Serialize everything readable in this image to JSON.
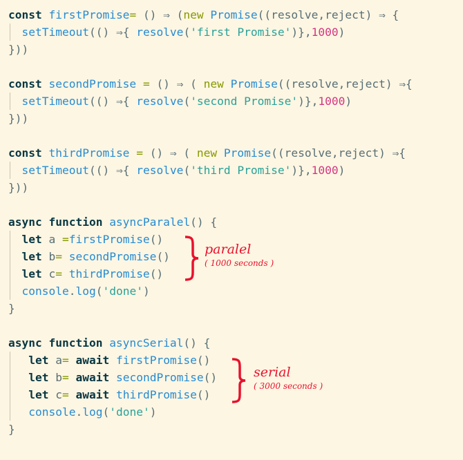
{
  "code_lines": [
    {
      "indent": false,
      "tokens": [
        [
          "const ",
          "kw"
        ],
        [
          "firstPromise",
          "fn"
        ],
        [
          "= ",
          "nw"
        ],
        [
          "() ⇒ (",
          "p"
        ],
        [
          "new ",
          "nw"
        ],
        [
          "Promise",
          "fn"
        ],
        [
          "((resolve,reject) ⇒ {",
          "p"
        ]
      ]
    },
    {
      "indent": true,
      "tokens": [
        [
          "  ",
          ""
        ],
        [
          "setTimeout",
          "fn"
        ],
        [
          "(() ⇒{ ",
          "p"
        ],
        [
          "resolve",
          "fn"
        ],
        [
          "(",
          "p"
        ],
        [
          "'first Promise'",
          "str"
        ],
        [
          ")},",
          "p"
        ],
        [
          "1000",
          "num"
        ],
        [
          ")",
          "p"
        ]
      ]
    },
    {
      "indent": false,
      "tokens": [
        [
          "}))",
          "p"
        ]
      ]
    },
    {
      "indent": false,
      "tokens": []
    },
    {
      "indent": false,
      "tokens": [
        [
          "const ",
          "kw"
        ],
        [
          "secondPromise ",
          "fn"
        ],
        [
          "= ",
          "nw"
        ],
        [
          "() ⇒ ( ",
          "p"
        ],
        [
          "new ",
          "nw"
        ],
        [
          "Promise",
          "fn"
        ],
        [
          "((resolve,reject) ⇒{",
          "p"
        ]
      ]
    },
    {
      "indent": true,
      "tokens": [
        [
          "  ",
          ""
        ],
        [
          "setTimeout",
          "fn"
        ],
        [
          "(() ⇒{ ",
          "p"
        ],
        [
          "resolve",
          "fn"
        ],
        [
          "(",
          "p"
        ],
        [
          "'second Promise'",
          "str"
        ],
        [
          ")},",
          "p"
        ],
        [
          "1000",
          "num"
        ],
        [
          ")",
          "p"
        ]
      ]
    },
    {
      "indent": false,
      "tokens": [
        [
          "}))",
          "p"
        ]
      ]
    },
    {
      "indent": false,
      "tokens": []
    },
    {
      "indent": false,
      "tokens": [
        [
          "const ",
          "kw"
        ],
        [
          "thirdPromise ",
          "fn"
        ],
        [
          "= ",
          "nw"
        ],
        [
          "() ⇒ ( ",
          "p"
        ],
        [
          "new ",
          "nw"
        ],
        [
          "Promise",
          "fn"
        ],
        [
          "((resolve,reject) ⇒{",
          "p"
        ]
      ]
    },
    {
      "indent": true,
      "tokens": [
        [
          "  ",
          ""
        ],
        [
          "setTimeout",
          "fn"
        ],
        [
          "(() ⇒{ ",
          "p"
        ],
        [
          "resolve",
          "fn"
        ],
        [
          "(",
          "p"
        ],
        [
          "'third Promise'",
          "str"
        ],
        [
          ")},",
          "p"
        ],
        [
          "1000",
          "num"
        ],
        [
          ")",
          "p"
        ]
      ]
    },
    {
      "indent": false,
      "tokens": [
        [
          "}))",
          "p"
        ]
      ]
    },
    {
      "indent": false,
      "tokens": []
    },
    {
      "indent": false,
      "tokens": [
        [
          "async function ",
          "kw"
        ],
        [
          "asyncParalel",
          "fn"
        ],
        [
          "() {",
          "p"
        ]
      ]
    },
    {
      "indent": true,
      "tokens": [
        [
          "  ",
          ""
        ],
        [
          "let ",
          "kw"
        ],
        [
          "a ",
          "p"
        ],
        [
          "=",
          "nw"
        ],
        [
          "firstPromise",
          "fn"
        ],
        [
          "()",
          "p"
        ]
      ]
    },
    {
      "indent": true,
      "tokens": [
        [
          "  ",
          ""
        ],
        [
          "let ",
          "kw"
        ],
        [
          "b",
          "p"
        ],
        [
          "= ",
          "nw"
        ],
        [
          "secondPromise",
          "fn"
        ],
        [
          "()",
          "p"
        ]
      ]
    },
    {
      "indent": true,
      "tokens": [
        [
          "  ",
          ""
        ],
        [
          "let ",
          "kw"
        ],
        [
          "c",
          "p"
        ],
        [
          "= ",
          "nw"
        ],
        [
          "thirdPromise",
          "fn"
        ],
        [
          "()",
          "p"
        ]
      ]
    },
    {
      "indent": true,
      "tokens": [
        [
          "  ",
          ""
        ],
        [
          "console",
          "fn"
        ],
        [
          ".",
          "p"
        ],
        [
          "log",
          "fn"
        ],
        [
          "(",
          "p"
        ],
        [
          "'done'",
          "str"
        ],
        [
          ")",
          "p"
        ]
      ]
    },
    {
      "indent": false,
      "tokens": [
        [
          "}",
          "p"
        ]
      ]
    },
    {
      "indent": false,
      "tokens": []
    },
    {
      "indent": false,
      "tokens": [
        [
          "async function ",
          "kw"
        ],
        [
          "asyncSerial",
          "fn"
        ],
        [
          "() {",
          "p"
        ]
      ]
    },
    {
      "indent": true,
      "tokens": [
        [
          "   ",
          ""
        ],
        [
          "let ",
          "kw"
        ],
        [
          "a",
          "p"
        ],
        [
          "= ",
          "nw"
        ],
        [
          "await ",
          "kw"
        ],
        [
          "firstPromise",
          "fn"
        ],
        [
          "()",
          "p"
        ]
      ]
    },
    {
      "indent": true,
      "tokens": [
        [
          "   ",
          ""
        ],
        [
          "let ",
          "kw"
        ],
        [
          "b",
          "p"
        ],
        [
          "= ",
          "nw"
        ],
        [
          "await ",
          "kw"
        ],
        [
          "secondPromise",
          "fn"
        ],
        [
          "()",
          "p"
        ]
      ]
    },
    {
      "indent": true,
      "tokens": [
        [
          "   ",
          ""
        ],
        [
          "let ",
          "kw"
        ],
        [
          "c",
          "p"
        ],
        [
          "= ",
          "nw"
        ],
        [
          "await ",
          "kw"
        ],
        [
          "thirdPromise",
          "fn"
        ],
        [
          "()",
          "p"
        ]
      ]
    },
    {
      "indent": true,
      "tokens": [
        [
          "   ",
          ""
        ],
        [
          "console",
          "fn"
        ],
        [
          ".",
          "p"
        ],
        [
          "log",
          "fn"
        ],
        [
          "(",
          "p"
        ],
        [
          "'done'",
          "str"
        ],
        [
          ")",
          "p"
        ]
      ]
    },
    {
      "indent": false,
      "tokens": [
        [
          "}",
          "p"
        ]
      ]
    }
  ],
  "annotations": {
    "paralel": {
      "title": "paralel",
      "subtitle": "( 1000 seconds )"
    },
    "serial": {
      "title": "serial",
      "subtitle": "( 3000 seconds )"
    }
  },
  "colors": {
    "background": "#fdf6e3",
    "annotation": "#e8112d"
  }
}
